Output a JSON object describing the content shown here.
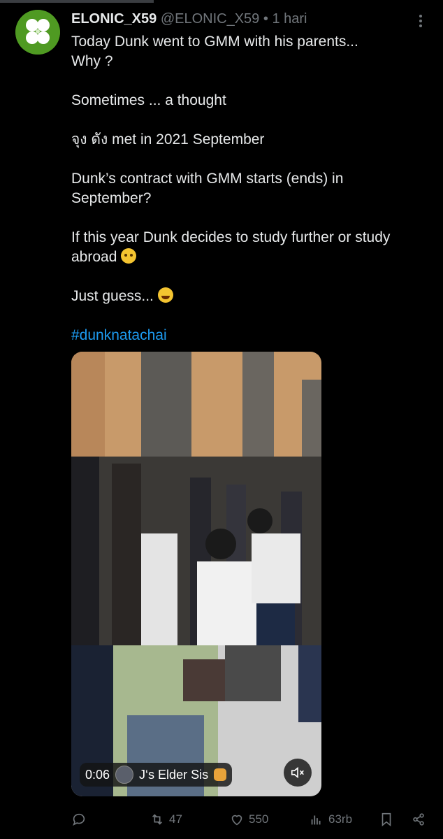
{
  "post": {
    "display_name": "ELONIC_X59",
    "handle": "@ELONIC_X59",
    "separator": "•",
    "time": "1 hari",
    "avatar_icon": "four-leaf-clover-icon",
    "paragraphs": [
      [
        "Today Dunk went to GMM with his parents...",
        "Why ?"
      ],
      [
        "Sometimes ... a thought"
      ],
      [
        "จุง ดัง met in 2021 September"
      ],
      [
        "Dunk’s contract with GMM starts (ends) in",
        "September?"
      ],
      [
        "If this year Dunk decides to study further or study",
        "abroad"
      ],
      [
        "Just guess..."
      ]
    ],
    "emoji_thinking": "thinking-face-emoji",
    "emoji_laughing": "laughing-face-emoji",
    "hashtag": "#dunknatachai"
  },
  "video": {
    "time": "0:06",
    "overlay_label": "J‘s Elder Sis",
    "muted": true
  },
  "actions": {
    "reply_count": "",
    "retweet_count": "47",
    "like_count": "550",
    "views_count": "63rb"
  },
  "colors": {
    "background": "#000000",
    "text": "#e7e9ea",
    "muted": "#71767b",
    "link": "#1d9bf0"
  }
}
